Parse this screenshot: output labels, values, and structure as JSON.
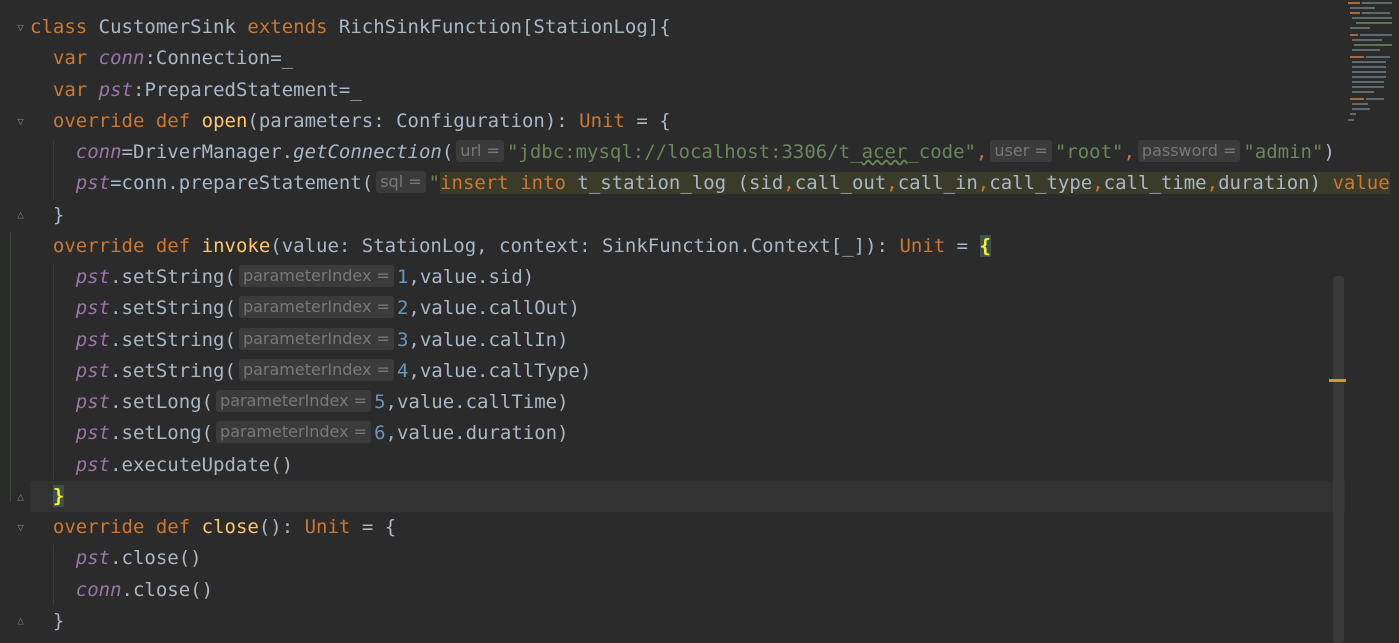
{
  "code": {
    "class_kw": "class",
    "class_name": "CustomerSink",
    "extends_kw": "extends",
    "parent": "RichSinkFunction[StationLog]{",
    "var_kw": "var",
    "conn": "conn",
    "conn_decl_rest": ":Connection=_",
    "pst": "pst",
    "pst_decl_rest": ":PreparedStatement=_",
    "override_kw": "override",
    "def_kw": "def",
    "open_fn": "open",
    "open_params": "(parameters: Configuration): ",
    "unit_kw": "Unit",
    "eq_brace": " = {",
    "eq": " = ",
    "open_brace": "{",
    "conn_assign_mid": "=DriverManager.",
    "get_conn": "getConnection",
    "paren_open": "(",
    "hint_url": "url =",
    "url_str": "\"jdbc:mysql://localhost:3306/t_",
    "url_str_sq": "acer",
    "url_str_end": "_code\"",
    "comma": ",",
    "hint_user": "user =",
    "user_str": "\"root\"",
    "hint_password": "password =",
    "password_str": "\"admin\"",
    "close_paren": ")",
    "prepare_mid": "=conn.prepareStatement(",
    "hint_sql": "sql =",
    "sql_quote": "\"",
    "sql_insert": "insert",
    "sql_into": "into",
    "sql_rest1": " t_station_log (sid",
    "sql_c1": "call_out",
    "sql_c2": "call_in",
    "sql_c3": "call_type",
    "sql_c4": "call_time",
    "sql_rest2": "duration) ",
    "sql_value": "value",
    "close_brace": "}",
    "invoke_fn": "invoke",
    "invoke_params": "(value: StationLog, context: SinkFunction.Context[_]): ",
    "set_string": ".setString(",
    "set_long": ".setLong(",
    "hint_param_index": "parameterIndex =",
    "idx1": "1",
    "idx2": "2",
    "idx3": "3",
    "idx4": "4",
    "idx5": "5",
    "idx6": "6",
    "val_sid": ",value.sid)",
    "val_callout": ",value.callOut)",
    "val_callin": ",value.callIn)",
    "val_calltype": ",value.callType)",
    "val_calltime": ",value.callTime)",
    "val_duration": ",value.duration)",
    "execute_update": ".executeUpdate()",
    "close_fn": "close",
    "close_params": "(): ",
    "close_call": ".close()"
  },
  "colors": {
    "background": "#2b2b2b",
    "keyword": "#cc7832",
    "string": "#6a8759",
    "number": "#6897bb",
    "function": "#ffc66d",
    "field": "#9876aa",
    "text": "#a9b7c6"
  }
}
